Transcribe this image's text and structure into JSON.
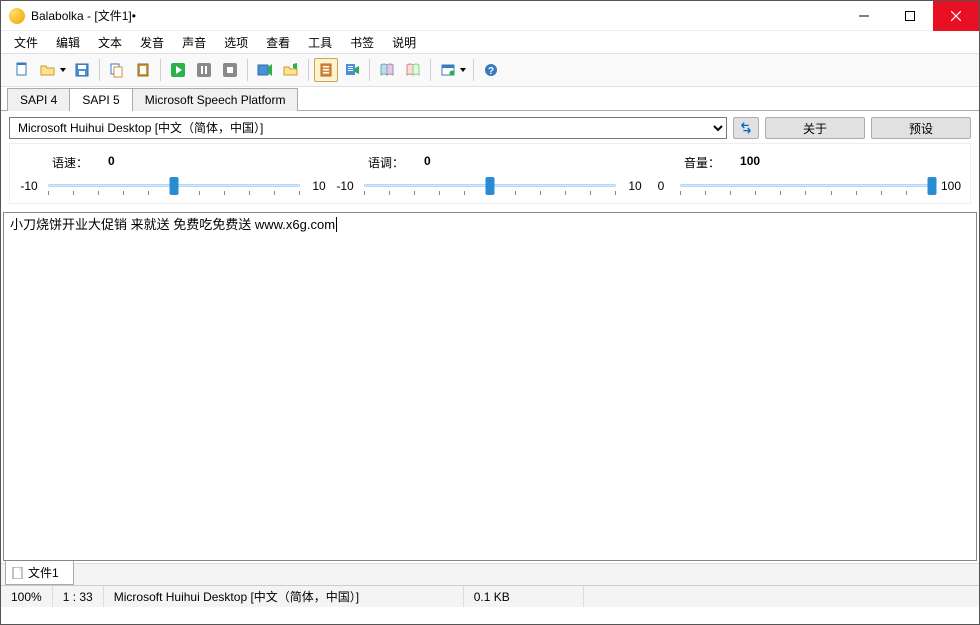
{
  "title": "Balabolka - [文件1]•",
  "menu": [
    "文件",
    "编辑",
    "文本",
    "发音",
    "声音",
    "选项",
    "查看",
    "工具",
    "书签",
    "说明"
  ],
  "tabs": [
    "SAPI 4",
    "SAPI 5",
    "Microsoft Speech Platform"
  ],
  "activeTab": 1,
  "voice": {
    "selected": "Microsoft Huihui Desktop [中文（简体，中国）]",
    "about": "关于",
    "presets": "预设"
  },
  "sliders": {
    "rate": {
      "label": "语速：",
      "value": "0",
      "min": "-10",
      "max": "10",
      "pos": 50
    },
    "pitch": {
      "label": "语调：",
      "value": "0",
      "min": "-10",
      "max": "10",
      "pos": 50
    },
    "volume": {
      "label": "音量：",
      "value": "100",
      "min": "0",
      "max": "100",
      "pos": 100
    }
  },
  "editorText": "小刀烧饼开业大促销 来就送 免费吃免费送 www.x6g.com",
  "docTab": "文件1",
  "status": {
    "zoom": "100%",
    "pos": "1 :  33",
    "voice": "Microsoft Huihui Desktop [中文（简体，中国）]",
    "size": "0.1 KB"
  }
}
